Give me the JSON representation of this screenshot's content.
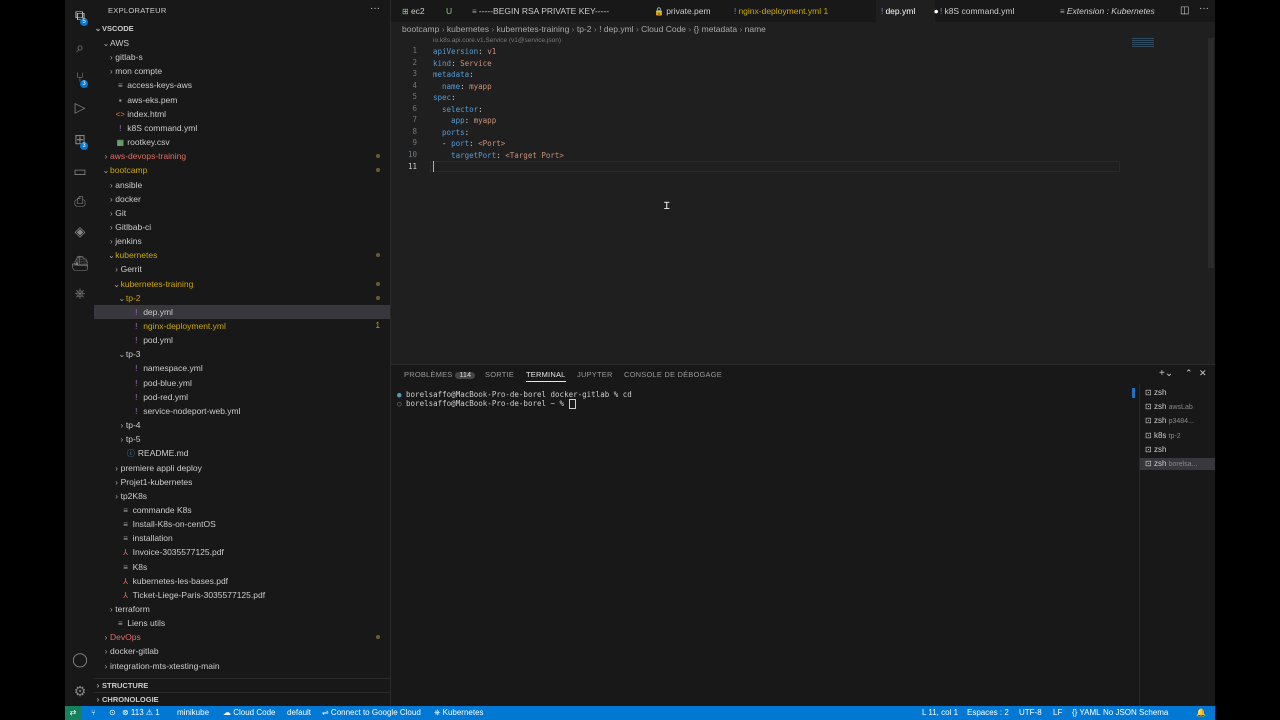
{
  "sidebar": {
    "title": "EXPLORATEUR",
    "more": "···",
    "root": "VSCODE",
    "tree": [
      {
        "label": "AWS",
        "depth": 0,
        "chev": "⌄",
        "color": "#cccccc"
      },
      {
        "label": "gitlab-s",
        "depth": 1,
        "chev": "›",
        "color": "#cccccc"
      },
      {
        "label": "mon compte",
        "depth": 1,
        "chev": "›",
        "color": "#cccccc"
      },
      {
        "label": "access-keys-aws",
        "depth": 1,
        "icon": "≡",
        "iconColor": "#aaaaaa",
        "color": "#cccccc"
      },
      {
        "label": "aws-eks.pem",
        "depth": 1,
        "icon": "▪",
        "iconColor": "#aaaaaa",
        "color": "#cccccc"
      },
      {
        "label": "index.html",
        "depth": 1,
        "icon": "<>",
        "iconColor": "#e37933",
        "color": "#cccccc"
      },
      {
        "label": "k8S command.yml",
        "depth": 1,
        "icon": "!",
        "iconColor": "#a074c4",
        "color": "#cccccc"
      },
      {
        "label": "rootkey.csv",
        "depth": 1,
        "icon": "▦",
        "iconColor": "#89d185",
        "color": "#cccccc"
      },
      {
        "label": "aws-devops-training",
        "depth": 0,
        "chev": "›",
        "color": "#e06c60",
        "dot": true
      },
      {
        "label": "bootcamp",
        "depth": 0,
        "chev": "⌄",
        "color": "#cca700",
        "dot": true
      },
      {
        "label": "ansible",
        "depth": 1,
        "chev": "›",
        "color": "#cccccc"
      },
      {
        "label": "docker",
        "depth": 1,
        "chev": "›",
        "color": "#cccccc"
      },
      {
        "label": "Git",
        "depth": 1,
        "chev": "›",
        "color": "#cccccc"
      },
      {
        "label": "Gitlbab-ci",
        "depth": 1,
        "chev": "›",
        "color": "#cccccc"
      },
      {
        "label": "jenkins",
        "depth": 1,
        "chev": "›",
        "color": "#cccccc"
      },
      {
        "label": "kubernetes",
        "depth": 1,
        "chev": "⌄",
        "color": "#cca700",
        "dot": true
      },
      {
        "label": "Gerrit",
        "depth": 2,
        "chev": "›",
        "color": "#cccccc"
      },
      {
        "label": "kubernetes-training",
        "depth": 2,
        "chev": "⌄",
        "color": "#cca700",
        "dot": true
      },
      {
        "label": "tp-2",
        "depth": 3,
        "chev": "⌄",
        "color": "#cca700",
        "dot": true
      },
      {
        "label": "dep.yml",
        "depth": 4,
        "icon": "!",
        "iconColor": "#a074c4",
        "color": "#cccccc",
        "sel": true
      },
      {
        "label": "nginx-deployment.yml",
        "depth": 4,
        "icon": "!",
        "iconColor": "#a074c4",
        "color": "#cca700",
        "num": "1"
      },
      {
        "label": "pod.yml",
        "depth": 4,
        "icon": "!",
        "iconColor": "#a074c4",
        "color": "#cccccc"
      },
      {
        "label": "tp-3",
        "depth": 3,
        "chev": "⌄",
        "color": "#cccccc"
      },
      {
        "label": "namespace.yml",
        "depth": 4,
        "icon": "!",
        "iconColor": "#a074c4",
        "color": "#cccccc"
      },
      {
        "label": "pod-blue.yml",
        "depth": 4,
        "icon": "!",
        "iconColor": "#a074c4",
        "color": "#cccccc"
      },
      {
        "label": "pod-red.yml",
        "depth": 4,
        "icon": "!",
        "iconColor": "#a074c4",
        "color": "#cccccc"
      },
      {
        "label": "service-nodeport-web.yml",
        "depth": 4,
        "icon": "!",
        "iconColor": "#a074c4",
        "color": "#cccccc"
      },
      {
        "label": "tp-4",
        "depth": 3,
        "chev": "›",
        "color": "#cccccc"
      },
      {
        "label": "tp-5",
        "depth": 3,
        "chev": "›",
        "color": "#cccccc"
      },
      {
        "label": "README.md",
        "depth": 3,
        "icon": "ⓘ",
        "iconColor": "#519aba",
        "color": "#cccccc"
      },
      {
        "label": "premiere appli deploy",
        "depth": 2,
        "chev": "›",
        "color": "#cccccc"
      },
      {
        "label": "Projet1-kubernetes",
        "depth": 2,
        "chev": "›",
        "color": "#cccccc"
      },
      {
        "label": "tp2K8s",
        "depth": 2,
        "chev": "›",
        "color": "#cccccc"
      },
      {
        "label": "commande K8s",
        "depth": 2,
        "icon": "≡",
        "iconColor": "#aaaaaa",
        "color": "#cccccc"
      },
      {
        "label": "Install-K8s-on-centOS",
        "depth": 2,
        "icon": "≡",
        "iconColor": "#aaaaaa",
        "color": "#cccccc"
      },
      {
        "label": "installation",
        "depth": 2,
        "icon": "≡",
        "iconColor": "#aaaaaa",
        "color": "#cccccc"
      },
      {
        "label": "Invoice-3035577125.pdf",
        "depth": 2,
        "icon": "⅄",
        "iconColor": "#e06c60",
        "color": "#cccccc"
      },
      {
        "label": "K8s",
        "depth": 2,
        "icon": "≡",
        "iconColor": "#aaaaaa",
        "color": "#cccccc"
      },
      {
        "label": "kubernetes-les-bases.pdf",
        "depth": 2,
        "icon": "⅄",
        "iconColor": "#e06c60",
        "color": "#cccccc"
      },
      {
        "label": "Ticket-Liege-Paris-3035577125.pdf",
        "depth": 2,
        "icon": "⅄",
        "iconColor": "#e06c60",
        "color": "#cccccc"
      },
      {
        "label": "terraform",
        "depth": 1,
        "chev": "›",
        "color": "#cccccc"
      },
      {
        "label": "Liens utils",
        "depth": 1,
        "icon": "≡",
        "iconColor": "#aaaaaa",
        "color": "#cccccc"
      },
      {
        "label": "DevOps",
        "depth": 0,
        "chev": "›",
        "color": "#e06c60",
        "dot": true
      },
      {
        "label": "docker-gitlab",
        "depth": 0,
        "chev": "›",
        "color": "#cccccc"
      },
      {
        "label": "integration-mts-xtesting-main",
        "depth": 0,
        "chev": "›",
        "color": "#cccccc"
      }
    ],
    "sections": [
      "STRUCTURE",
      "CHRONOLOGIE"
    ]
  },
  "tabs": [
    {
      "label": "ec2",
      "icon": "⊞",
      "iconColor": "#89d185",
      "color": "#cccccc"
    },
    {
      "label": "U",
      "icon": "",
      "iconColor": "",
      "color": "#89d185"
    },
    {
      "label": "-----BEGIN RSA PRIVATE KEY-----",
      "icon": "≡",
      "iconColor": "#aaaaaa",
      "color": "#cccccc"
    },
    {
      "label": "private.pem",
      "icon": "🔒",
      "iconColor": "#cca700",
      "color": "#cccccc"
    },
    {
      "label": "nginx-deployment.yml 1",
      "icon": "!",
      "iconColor": "#a074c4",
      "color": "#cca700"
    },
    {
      "label": "dep.yml",
      "icon": "!",
      "iconColor": "#a074c4",
      "color": "#ffffff",
      "active": true
    },
    {
      "label": "k8S command.yml",
      "icon": "!",
      "iconColor": "#a074c4",
      "color": "#cccccc"
    },
    {
      "label": "Extension : Kubernetes",
      "icon": "≡",
      "iconColor": "#aaaaaa",
      "color": "#cccccc",
      "italic": true
    }
  ],
  "breadcrumb": [
    "bootcamp",
    "kubernetes",
    "kubernetes-training",
    "tp-2",
    "! dep.yml",
    "Cloud Code",
    "{} metadata",
    "name"
  ],
  "editor": {
    "hint": "io.k8s.api.core.v1.Service (v1@service.json)",
    "lines": [
      [
        {
          "t": "apiVersion",
          "c": "k"
        },
        {
          "t": ": ",
          "c": "p"
        },
        {
          "t": "v1",
          "c": "v"
        }
      ],
      [
        {
          "t": "kind",
          "c": "k"
        },
        {
          "t": ": ",
          "c": "p"
        },
        {
          "t": "Service",
          "c": "v"
        }
      ],
      [
        {
          "t": "metadata",
          "c": "k"
        },
        {
          "t": ":",
          "c": "p"
        }
      ],
      [
        {
          "t": "  name",
          "c": "k"
        },
        {
          "t": ": ",
          "c": "p"
        },
        {
          "t": "myapp",
          "c": "v"
        }
      ],
      [
        {
          "t": "spec",
          "c": "k"
        },
        {
          "t": ":",
          "c": "p"
        }
      ],
      [
        {
          "t": "  selector",
          "c": "k"
        },
        {
          "t": ":",
          "c": "p"
        }
      ],
      [
        {
          "t": "    app",
          "c": "k"
        },
        {
          "t": ": ",
          "c": "p"
        },
        {
          "t": "myapp",
          "c": "v"
        }
      ],
      [
        {
          "t": "  ports",
          "c": "k"
        },
        {
          "t": ":",
          "c": "p"
        }
      ],
      [
        {
          "t": "  - ",
          "c": "p"
        },
        {
          "t": "port",
          "c": "k"
        },
        {
          "t": ": ",
          "c": "p"
        },
        {
          "t": "<Port>",
          "c": "v"
        }
      ],
      [
        {
          "t": "    targetPort",
          "c": "k"
        },
        {
          "t": ": ",
          "c": "p"
        },
        {
          "t": "<Target Port>",
          "c": "v"
        }
      ],
      []
    ]
  },
  "panel": {
    "tabs": [
      "PROBLÈMES",
      "SORTIE",
      "TERMINAL",
      "JUPYTER",
      "CONSOLE DE DÉBOGAGE"
    ],
    "problems_count": "114",
    "active_tab": "TERMINAL",
    "terminal_lines": [
      "borelsaffo@MacBook-Pro-de-borel docker-gitlab % cd",
      "borelsaffo@MacBook-Pro-de-borel ~ % "
    ],
    "terminals": [
      {
        "name": "zsh",
        "sub": ""
      },
      {
        "name": "zsh",
        "sub": "awsLab"
      },
      {
        "name": "zsh",
        "sub": "p3484..."
      },
      {
        "name": "k8s",
        "sub": "tp-2"
      },
      {
        "name": "zsh",
        "sub": ""
      },
      {
        "name": "zsh",
        "sub": "borelsa...",
        "sel": true
      }
    ]
  },
  "status": {
    "left": [
      "⊗ 113 ⚠ 1",
      "minikube",
      "☁ Cloud Code",
      "default",
      "⇌ Connect to Google Cloud",
      "⎈ Kubernetes"
    ],
    "right": [
      "L 11, col 1",
      "Espaces : 2",
      "UTF-8",
      "LF",
      "{} YAML",
      "No JSON Schema"
    ]
  },
  "colors": {
    "accent": "#0078d4",
    "modified": "#cca700",
    "error": "#e06c60"
  }
}
